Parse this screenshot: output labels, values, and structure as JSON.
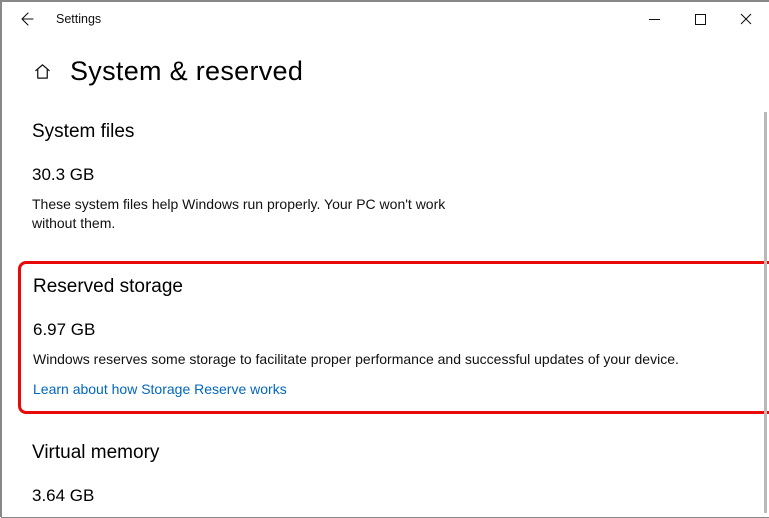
{
  "window": {
    "title": "Settings"
  },
  "page": {
    "title": "System & reserved"
  },
  "sections": {
    "system_files": {
      "heading": "System files",
      "value": "30.3 GB",
      "description": "These system files help Windows run properly. Your PC won't work without them."
    },
    "reserved_storage": {
      "heading": "Reserved storage",
      "value": "6.97 GB",
      "description": "Windows reserves some storage to facilitate proper performance and successful updates of your device.",
      "link": "Learn about how Storage Reserve works"
    },
    "virtual_memory": {
      "heading": "Virtual memory",
      "value": "3.64 GB"
    }
  }
}
